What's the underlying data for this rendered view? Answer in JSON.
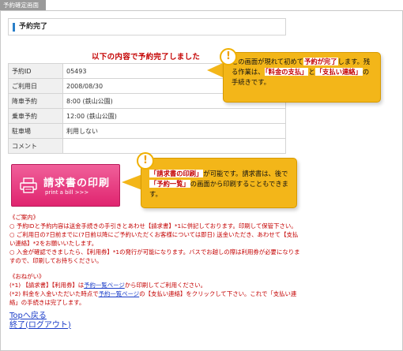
{
  "tab": {
    "label": "予約確定画面"
  },
  "section": {
    "title": "予約完了"
  },
  "headline": "以下の内容で予約完了しました",
  "table": {
    "rows": [
      {
        "key": "予約ID",
        "value": "05493"
      },
      {
        "key": "ご利用日",
        "value": "2008/08/30"
      },
      {
        "key": "降車予約",
        "value": "8:00 (鉄山公園)"
      },
      {
        "key": "乗車予約",
        "value": "12:00 (鉄山公園)"
      },
      {
        "key": "駐車場",
        "value": "利用しない"
      },
      {
        "key": "コメント",
        "value": ""
      }
    ]
  },
  "print_button": {
    "label": "請求書の印刷",
    "sub_label": "print a bill >>>"
  },
  "note1": {
    "t1": "この画面が現れて初めて",
    "e1": "予約が完了",
    "t2": "します。残る作業は、",
    "e2": "「料金の支払」",
    "t3": "と",
    "e3": "「支払い連絡」",
    "t4": "の手続きです。"
  },
  "note2": {
    "e1": "「請求書の印刷」",
    "t1": "が可能です。請求書は、後で",
    "e2": "「予約一覧」",
    "t2": "の画面から印刷することもできます。"
  },
  "guide": {
    "heading": "《ご案内》",
    "l1": "○ 予約IDと予約内容は送金手続きの手引きとあわせ【請求書】*1に併記しております。印刷して保管下さい。",
    "l2": "○ ご利用日の7日前までに(7日前以降にご予約いただくお客様については即日) 送金いただき、あわせて【支払い連絡】*2をお願いいたします。",
    "l3": "○ 入金が確認できましたら、【利用券】*1の発行が可能になります。バスでお越しの際は利用券が必要になりますので、印刷してお持ちください。",
    "heading2": "《おねがい》",
    "n1a": "(*1) 【請求書】【利用券】は",
    "n1link": "予約一覧ページ",
    "n1b": "から印刷してご利用ください。",
    "n2a": "(*2) 料金を入金いただいた時点で",
    "n2link": "予約一覧ページ",
    "n2b": "の【支払い連絡】をクリックして下さい。これで「支払い連絡」の手続きは完了します。"
  },
  "links": {
    "top": "Topへ戻る",
    "logout": "終了(ログアウト)"
  }
}
